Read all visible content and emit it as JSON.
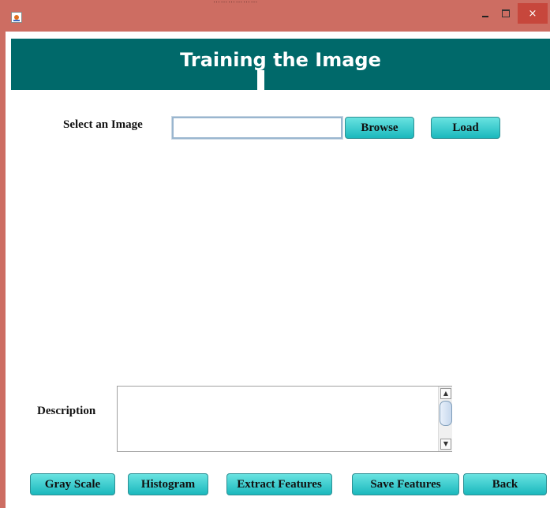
{
  "window": {
    "title": "………………",
    "controls": {
      "minimize": "–",
      "maximize": "□",
      "close": "×"
    },
    "icon": "java-cup-icon"
  },
  "header": {
    "title": "Training the Image",
    "background": "#00696a"
  },
  "image_select": {
    "label": "Select an Image",
    "input_value": "",
    "browse_label": "Browse",
    "load_label": "Load"
  },
  "description": {
    "label": "Description",
    "text": "",
    "scroll_up": "▲",
    "scroll_down": "▼"
  },
  "actions": {
    "gray_scale": "Gray Scale",
    "histogram": "Histogram",
    "extract_features": "Extract Features",
    "save_features": "Save Features",
    "back": "Back"
  },
  "colors": {
    "titlebar": "#cd6d62",
    "button": "#1ab8bd",
    "close": "#c7473c"
  }
}
